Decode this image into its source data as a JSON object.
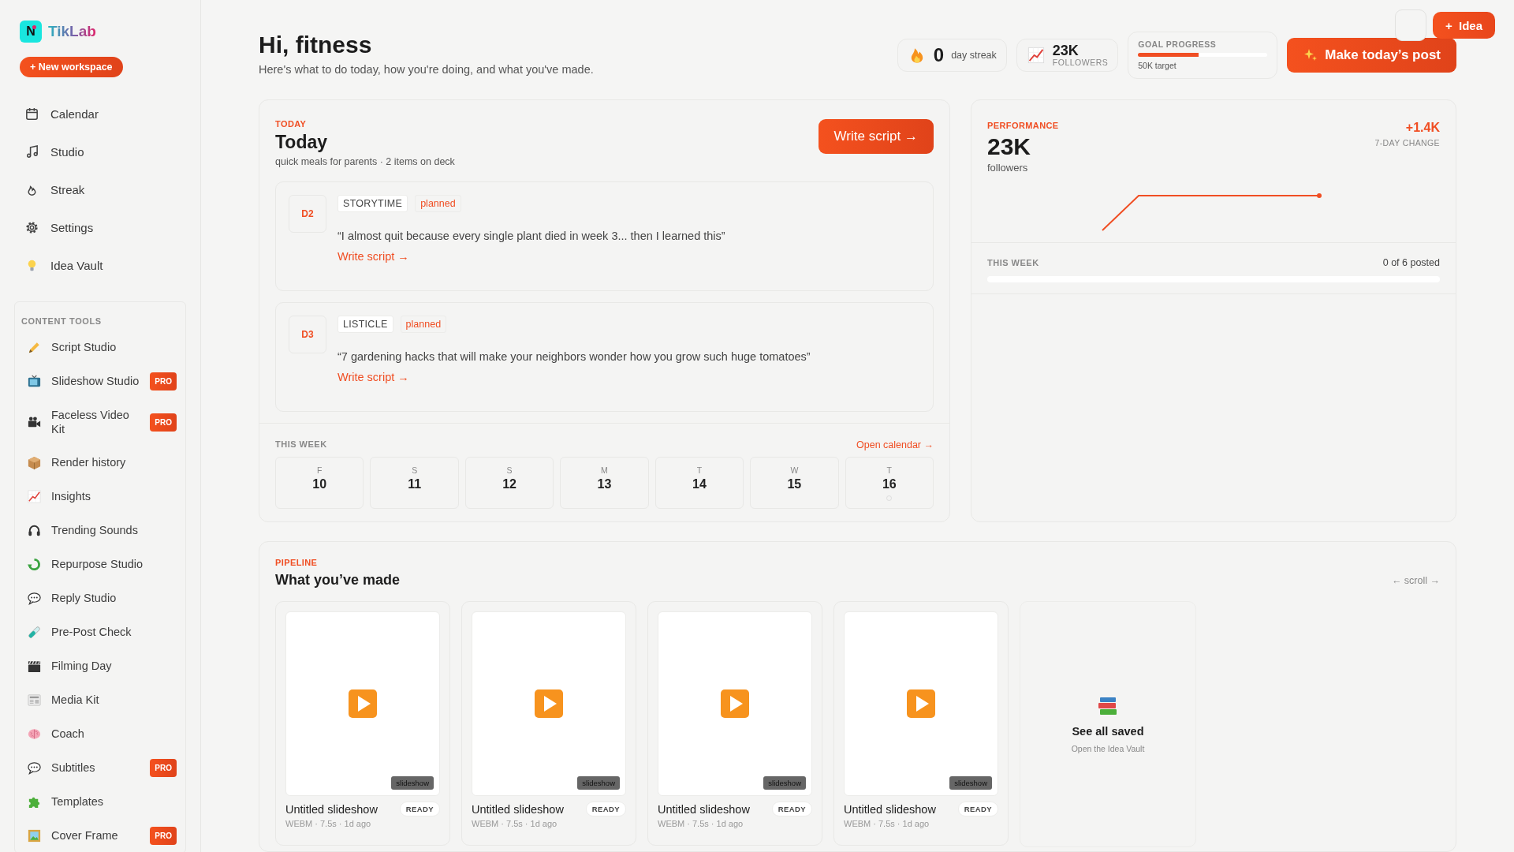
{
  "sidebar": {
    "logo": {
      "mark": "N",
      "name": "TikLab"
    },
    "new_button": "+ New workspace",
    "nav": [
      {
        "label": "Calendar"
      },
      {
        "label": "Studio"
      },
      {
        "label": "Streak"
      },
      {
        "label": "Settings"
      },
      {
        "label": "Idea Vault"
      }
    ],
    "tools_heading": "CONTENT TOOLS",
    "tools": [
      {
        "label": "Script Studio"
      },
      {
        "label": "Slideshow Studio",
        "badge": "PRO"
      },
      {
        "label": "Faceless Video Kit",
        "badge": "PRO"
      },
      {
        "label": "Render history"
      },
      {
        "label": "Insights"
      },
      {
        "label": "Trending Sounds"
      },
      {
        "label": "Repurpose Studio"
      },
      {
        "label": "Reply Studio"
      },
      {
        "label": "Pre-Post Check"
      },
      {
        "label": "Filming Day"
      },
      {
        "label": "Media Kit"
      },
      {
        "label": "Coach"
      },
      {
        "label": "Subtitles",
        "badge": "PRO"
      },
      {
        "label": "Templates"
      },
      {
        "label": "Cover Frame",
        "badge": "PRO"
      }
    ]
  },
  "header": {
    "greeting": "Hi, fitness",
    "subtitle": "Here's what to do today, how you're doing, and what you've made.",
    "streak": {
      "value": "0",
      "label": "day streak"
    },
    "followers": {
      "value": "23K",
      "label": "FOLLOWERS"
    },
    "goal": {
      "label": "GOAL PROGRESS",
      "level": 0.47,
      "caption": "50K target"
    },
    "primary_button": "Make today’s post",
    "idea_button": "+  Idea"
  },
  "today": {
    "eyebrow": "TODAY",
    "title": "Today",
    "subtitle": "quick meals for parents · 2 items on deck",
    "button": "Write script →",
    "items": [
      {
        "day": "D2",
        "format": "STORYTIME",
        "status": "planned",
        "hook": "“I almost quit because every single plant died in week 3... then I learned this”",
        "link": "Write script →"
      },
      {
        "day": "D3",
        "format": "LISTICLE",
        "status": "planned",
        "hook": "“7 gardening hacks that will make your neighbors wonder how you grow such huge tomatoes”",
        "link": "Write script →"
      }
    ],
    "week": {
      "heading": "THIS WEEK",
      "link": "Open calendar →",
      "days": [
        {
          "letter": "F",
          "date": "10",
          "today": false
        },
        {
          "letter": "S",
          "date": "11",
          "today": false
        },
        {
          "letter": "S",
          "date": "12",
          "today": false
        },
        {
          "letter": "M",
          "date": "13",
          "today": false
        },
        {
          "letter": "T",
          "date": "14",
          "today": false
        },
        {
          "letter": "W",
          "date": "15",
          "today": false
        },
        {
          "letter": "T",
          "date": "16",
          "today": true
        }
      ]
    }
  },
  "performance": {
    "eyebrow": "PERFORMANCE",
    "value": "23K",
    "unit": "followers",
    "change": "+1.4K",
    "change_label": "7-DAY CHANGE",
    "week": {
      "label": "THIS WEEK",
      "count": "0 of 6 posted",
      "level": 0
    }
  },
  "pipeline": {
    "eyebrow": "PIPELINE",
    "title": "What you’ve made",
    "scroll_hint": "← scroll →",
    "items": [
      {
        "kind": "video",
        "tag": "slideshow",
        "title": "Untitled slideshow",
        "status": "READY",
        "meta": "WEBM · 7.5s · 1d ago"
      },
      {
        "kind": "video",
        "tag": "slideshow",
        "title": "Untitled slideshow",
        "status": "READY",
        "meta": "WEBM · 7.5s · 1d ago"
      },
      {
        "kind": "video",
        "tag": "slideshow",
        "title": "Untitled slideshow",
        "status": "READY",
        "meta": "WEBM · 7.5s · 1d ago"
      },
      {
        "kind": "video",
        "tag": "slideshow",
        "title": "Untitled slideshow",
        "status": "READY",
        "meta": "WEBM · 7.5s · 1d ago"
      },
      {
        "kind": "see_all",
        "title": "See all saved",
        "caption": "Open the Idea Vault"
      }
    ]
  }
}
